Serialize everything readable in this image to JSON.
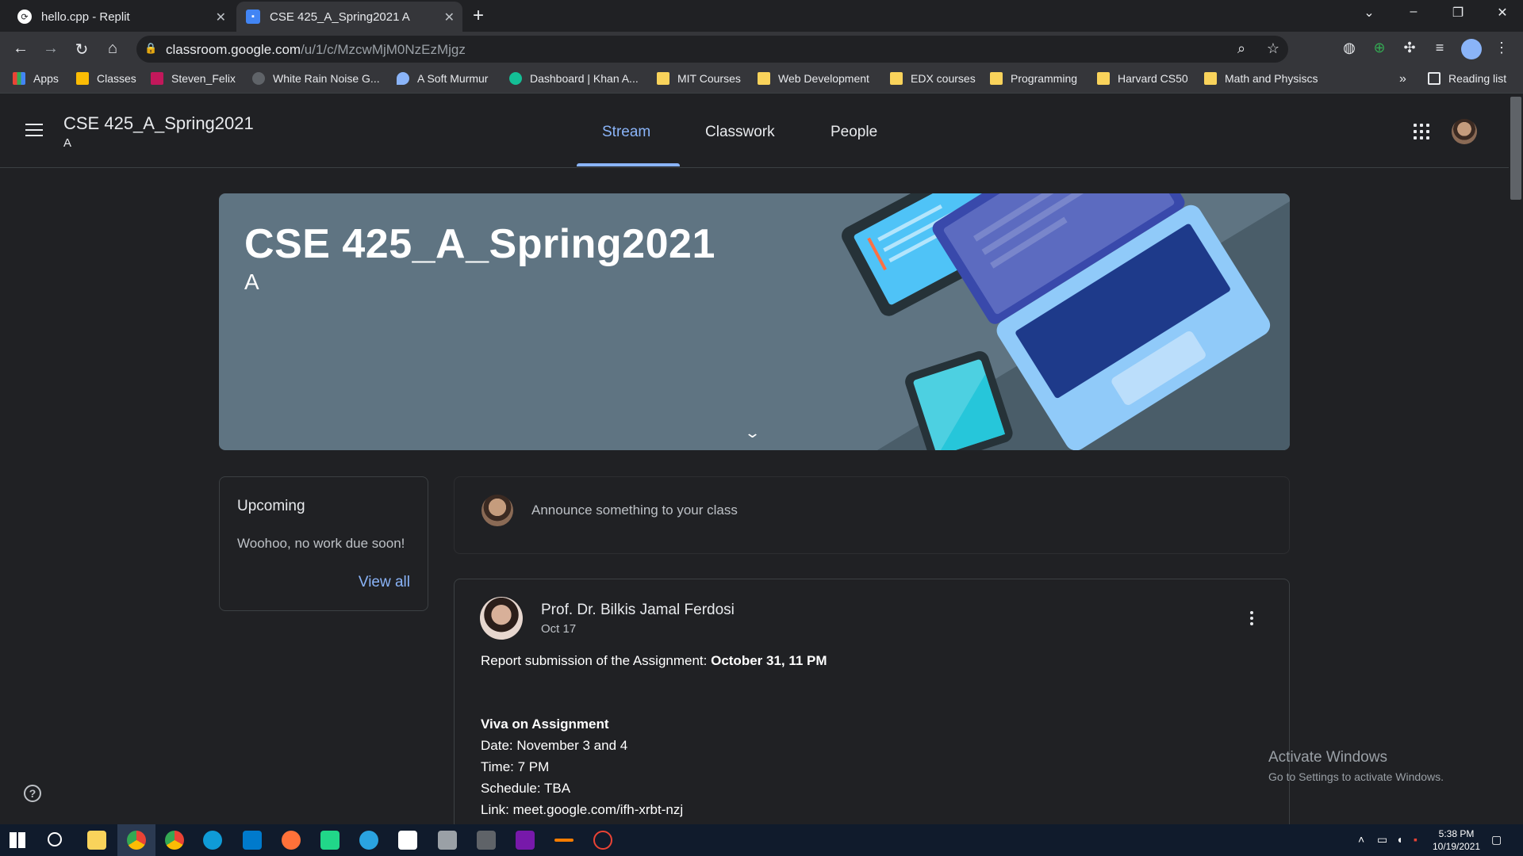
{
  "browser": {
    "tabs": [
      {
        "title": "hello.cpp - Replit",
        "icon": "replit-icon"
      },
      {
        "title": "CSE 425_A_Spring2021 A",
        "icon": "classroom-icon"
      }
    ],
    "new_tab": "+",
    "window_controls": {
      "menu": "⌄",
      "minimize": "–",
      "restore": "❐",
      "close": "✕"
    },
    "url_host": "classroom.google.com",
    "url_path": "/u/1/c/MzcwMjM0NzEzMjgz",
    "bookmarks": [
      {
        "label": "Apps",
        "icon": "apps-grid-icon"
      },
      {
        "label": "Classes",
        "icon": "classroom-icon"
      },
      {
        "label": "Steven_Felix",
        "icon": "uva-icon"
      },
      {
        "label": "White Rain Noise G...",
        "icon": "noise-icon"
      },
      {
        "label": "A Soft Murmur",
        "icon": "droplet-icon"
      },
      {
        "label": "Dashboard | Khan A...",
        "icon": "khan-icon"
      },
      {
        "label": "MIT Courses",
        "icon": "folder-icon"
      },
      {
        "label": "Web Development",
        "icon": "folder-icon"
      },
      {
        "label": "EDX courses",
        "icon": "folder-icon"
      },
      {
        "label": "Programming",
        "icon": "folder-icon"
      },
      {
        "label": "Harvard CS50",
        "icon": "folder-icon"
      },
      {
        "label": "Math and Physiscs",
        "icon": "folder-icon"
      }
    ],
    "bookmarks_overflow": "»",
    "reading_list": "Reading list"
  },
  "header": {
    "class_title": "CSE 425_A_Spring2021",
    "section": "A",
    "tabs": [
      {
        "label": "Stream",
        "active": true
      },
      {
        "label": "Classwork",
        "active": false
      },
      {
        "label": "People",
        "active": false
      }
    ]
  },
  "banner": {
    "title": "CSE 425_A_Spring2021",
    "section": "A",
    "color": "#5f7482"
  },
  "upcoming": {
    "title": "Upcoming",
    "text": "Woohoo, no work due soon!",
    "view_all": "View all"
  },
  "announce": {
    "placeholder": "Announce something to your class"
  },
  "post": {
    "author": "Prof. Dr. Bilkis Jamal Ferdosi",
    "date": "Oct 17",
    "line1_text": "Report submission of the Assignment: ",
    "line1_bold": "October 31, 11 PM",
    "viva_heading": "Viva on Assignment",
    "lines": [
      "Date: November 3 and 4",
      "Time: 7 PM",
      "Schedule: TBA",
      "Link: meet.google.com/ifh-xrbt-nzj"
    ]
  },
  "watermark": {
    "title": "Activate Windows",
    "subtitle": "Go to Settings to activate Windows."
  },
  "taskbar": {
    "time": "5:38 PM",
    "date": "10/19/2021"
  },
  "colors": {
    "accent": "#8ab4f8",
    "background": "#202124",
    "toolbar": "#35363a",
    "taskbar": "#101b2c"
  }
}
